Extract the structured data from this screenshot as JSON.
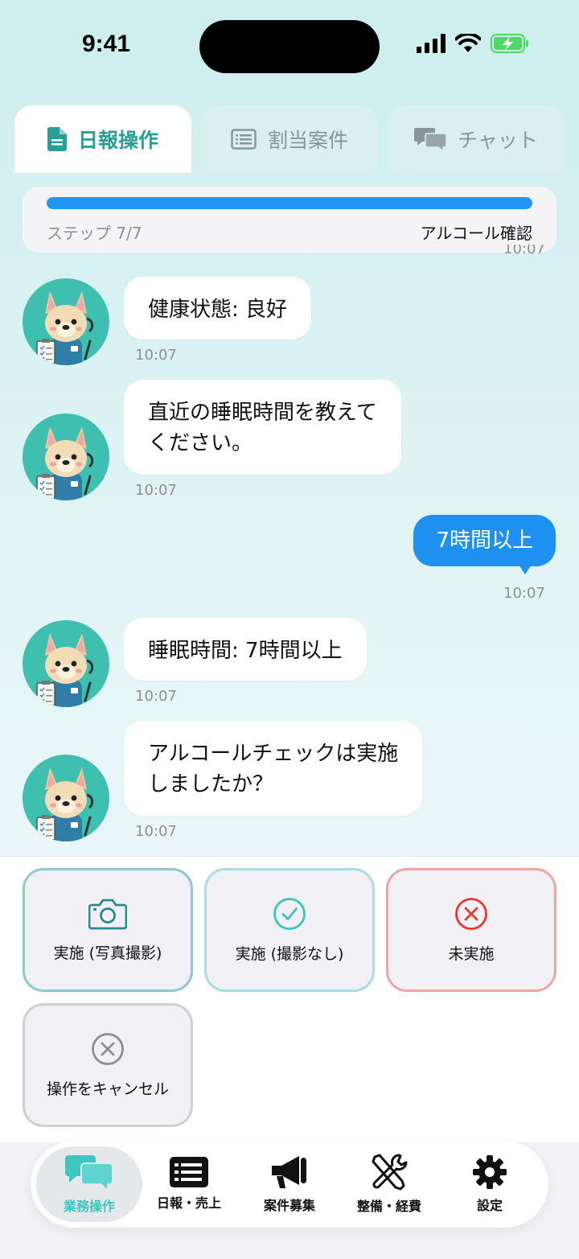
{
  "status_bar": {
    "time": "9:41"
  },
  "tabs": [
    {
      "label": "日報操作",
      "icon": "document-icon",
      "active": true
    },
    {
      "label": "割当案件",
      "icon": "list-icon",
      "active": false
    },
    {
      "label": "チャット",
      "icon": "chat-icon",
      "active": false
    }
  ],
  "progress": {
    "step_text": "ステップ 7/7",
    "step_title": "アルコール確認",
    "fraction": 1.0
  },
  "messages": [
    {
      "from": "bot",
      "text": "健康状態: 良好",
      "time": "10:07"
    },
    {
      "from": "bot",
      "line1": "直近の睡眠時間を教えて",
      "line2": "ください。",
      "time": "10:07"
    },
    {
      "from": "user",
      "text": "7時間以上",
      "time": "10:07"
    },
    {
      "from": "bot",
      "text": "睡眠時間: 7時間以上",
      "time": "10:07"
    },
    {
      "from": "bot",
      "line1": "アルコールチェックは実施",
      "line2": "しましたか？",
      "time": "10:07"
    }
  ],
  "prev_time": "10:07",
  "options": [
    {
      "label": "実施 (写真撮影)",
      "icon": "camera-icon",
      "color": "#2a8a8e"
    },
    {
      "label": "実施 (撮影なし)",
      "icon": "check-circle-icon",
      "color": "#3cc3bd"
    },
    {
      "label": "未実施",
      "icon": "x-circle-icon",
      "color": "#e53935"
    },
    {
      "label": "操作をキャンセル",
      "icon": "cancel-circle-icon",
      "color": "#8e8e93"
    }
  ],
  "nav": [
    {
      "label": "業務操作",
      "icon": "chat-bubbles-icon",
      "active": true
    },
    {
      "label": "日報・売上",
      "icon": "list-icon",
      "active": false
    },
    {
      "label": "案件募集",
      "icon": "megaphone-icon",
      "active": false
    },
    {
      "label": "整備・経費",
      "icon": "tools-icon",
      "active": false
    },
    {
      "label": "設定",
      "icon": "gear-icon",
      "active": false
    }
  ],
  "colors": {
    "accent": "#2a9d96",
    "user_bubble": "#1e90f0",
    "progress": "#2196f3"
  }
}
